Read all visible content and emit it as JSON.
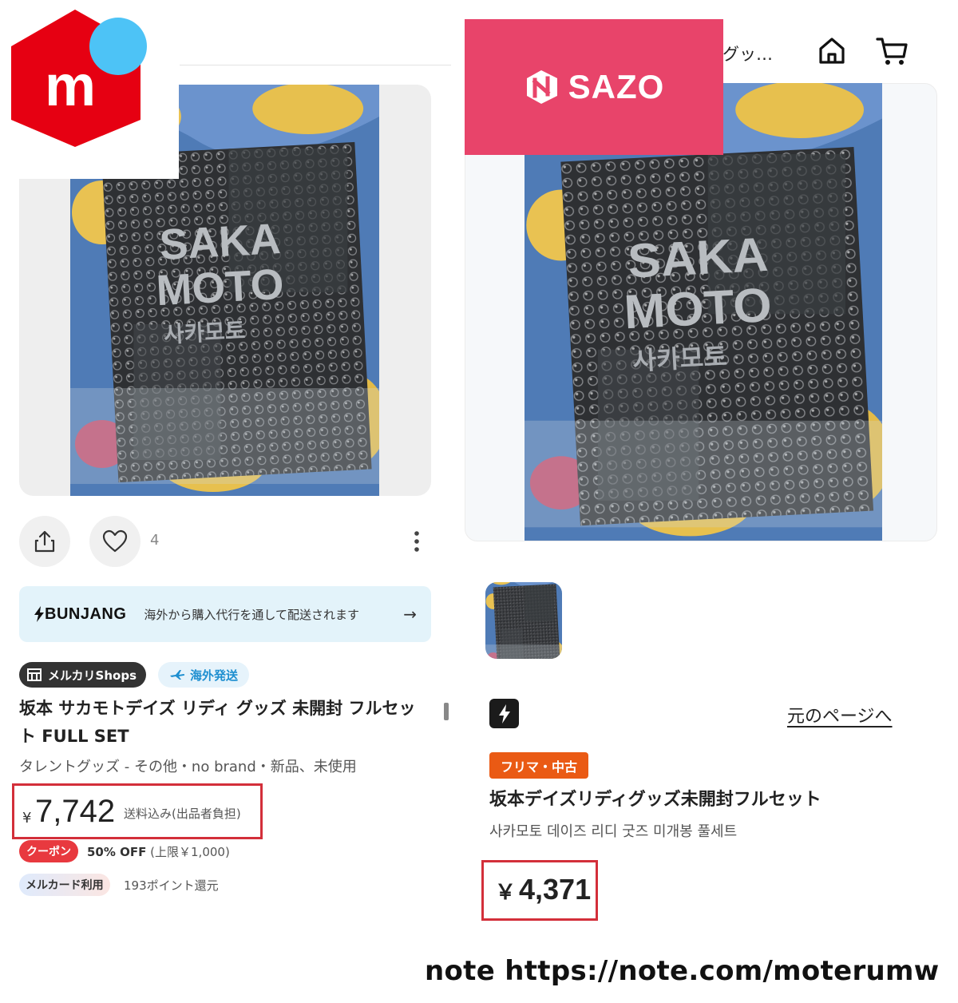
{
  "left": {
    "brand_logo_letter": "m",
    "likes": "4",
    "bunjang": {
      "brand": "BUNJANG",
      "text": "海外から購入代行を通して配送されます",
      "arrow": "→"
    },
    "badges": {
      "shops": "メルカリShops",
      "overseas": "海外発送"
    },
    "title": "坂本 サカモトデイズ リディ グッズ 未開封 フルセット FULL SET",
    "meta": "タレントグッズ - その他・no brand・新品、未使用",
    "price": {
      "currency": "¥",
      "value": "7,742",
      "shipping": "送料込み(出品者負担)"
    },
    "coupon": {
      "badge": "クーポン",
      "discount": "50% OFF",
      "limit": "(上限￥1,000)"
    },
    "card": {
      "badge": "メルカード利用",
      "points": "193ポイント還元"
    }
  },
  "right": {
    "logo_text": "SAZO",
    "header_text": "グッ…",
    "orig_link": "元のページへ",
    "badge": "フリマ・中古",
    "title": "坂本デイズリディグッズ未開封フルセット",
    "subtitle": "사카모토 데이즈 리디 굿즈 미개봉 풀세트",
    "price": {
      "currency": "￥",
      "value": "4,371"
    }
  },
  "photo": {
    "word_top": "SAKA",
    "word_bottom": "MOTO",
    "sub": "사카모토"
  },
  "footer": "note https://note.com/moterumw",
  "colors": {
    "mercari_red": "#e60012",
    "mercari_blue": "#4dc3f6",
    "sazo_pink": "#e8446a",
    "highlight_red": "#d32f3a",
    "flea_orange": "#ea5a14"
  }
}
